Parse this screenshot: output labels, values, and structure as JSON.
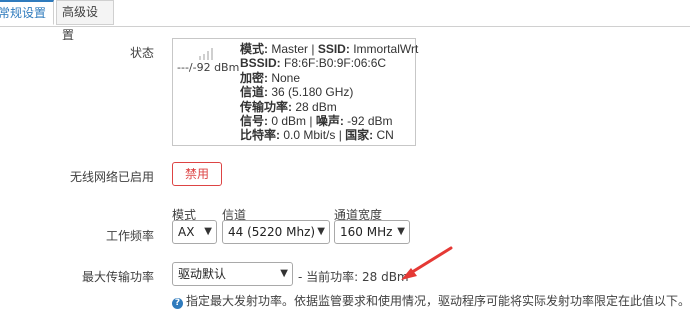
{
  "tabs": [
    {
      "label": "常规设置",
      "active": true
    },
    {
      "label": "高级设置",
      "active": false
    }
  ],
  "status": {
    "label": "状态",
    "rssi": "---/-92 dBm",
    "mode_label": "模式:",
    "mode_value": "Master",
    "ssid_label": "SSID:",
    "ssid_value": "ImmortalWrt",
    "bssid_label": "BSSID:",
    "bssid_value": "F8:6F:B0:9F:06:6C",
    "encryption_label": "加密:",
    "encryption_value": "None",
    "channel_label": "信道:",
    "channel_value": "36 (5.180 GHz)",
    "txpower_label": "传输功率:",
    "txpower_value": "28 dBm",
    "signal_label": "信号:",
    "signal_value": "0 dBm",
    "noise_label": "噪声:",
    "noise_value": "-92 dBm",
    "bitrate_label": "比特率:",
    "bitrate_value": "0.0 Mbit/s",
    "country_label": "国家:",
    "country_value": "CN"
  },
  "wireless": {
    "label": "无线网络已启用",
    "disable_button": "禁用"
  },
  "frequency": {
    "label": "工作频率",
    "mode_sublabel": "模式",
    "channel_sublabel": "信道",
    "width_sublabel": "通道宽度",
    "mode_value": "AX",
    "channel_value": "44 (5220 Mhz)",
    "width_value": "160 MHz"
  },
  "txpower": {
    "label": "最大传输功率",
    "select_value": "驱动默认",
    "current_text": "- 当前功率: 28 dBm",
    "help_text": "指定最大发射功率。依据监管要求和使用情况，驱动程序可能将实际发射功率限定在此值以下。"
  },
  "colors": {
    "accent": "#2f7bbd",
    "danger": "#dd4444",
    "arrow": "#e53935"
  },
  "icons": {
    "signal": "signal-strength-icon",
    "help": "help-circle-icon",
    "chevron": "chevron-down-icon",
    "arrow": "red-arrow-annotation-icon"
  }
}
